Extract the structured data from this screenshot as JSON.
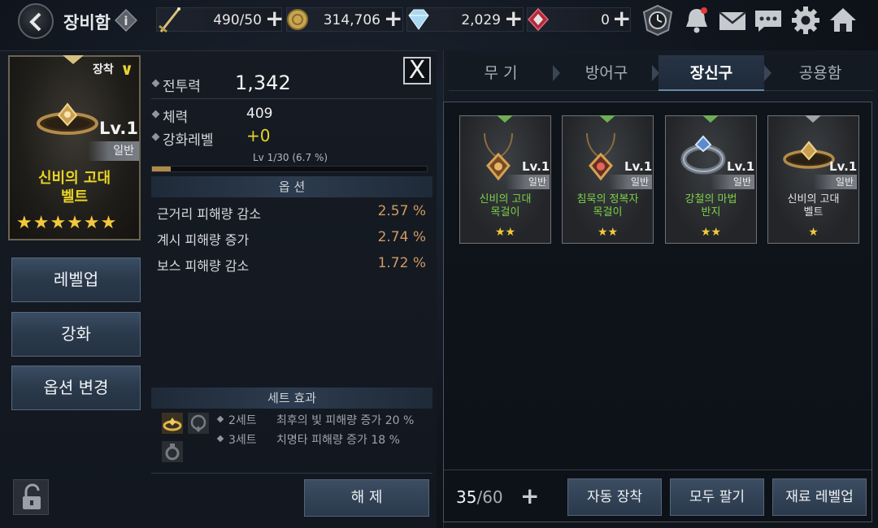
{
  "header": {
    "title": "장비함",
    "resources": [
      {
        "icon": "sword-icon",
        "value": "490/50"
      },
      {
        "icon": "gold-coin-icon",
        "value": "314,706"
      },
      {
        "icon": "diamond-gem-icon",
        "value": "2,029"
      },
      {
        "icon": "red-gem-icon",
        "value": "0"
      }
    ],
    "plus": "+"
  },
  "item": {
    "equip_label": "장착",
    "level": "Lv.1",
    "grade": "일반",
    "name_line1": "신비의 고대",
    "name_line2": "벨트",
    "stars": "★★★★★★",
    "star_count": 6
  },
  "left_buttons": {
    "levelup": "레벨업",
    "enhance": "강화",
    "option_change": "옵션 변경"
  },
  "stats": {
    "power_label": "전투력",
    "power_value": "1,342",
    "stamina_label": "체력",
    "stamina_value": "409",
    "enhance_label": "강화레벨",
    "enhance_value": "+0",
    "xp_text": "Lv 1/30  (6.7 %)",
    "xp_fraction": 0.067,
    "close": "X"
  },
  "options": {
    "header": "옵 션",
    "rows": [
      {
        "name": "근거리 피해량 감소",
        "value": "2.57 %"
      },
      {
        "name": "계시 피해량 증가",
        "value": "2.74 %"
      },
      {
        "name": "보스 피해량 감소",
        "value": "1.72 %"
      }
    ]
  },
  "set_effect": {
    "header": "세트 효과",
    "rows": [
      {
        "count": "2세트",
        "desc": "최후의 빛 피해량 증가 20 %"
      },
      {
        "count": "3세트",
        "desc": "치명타 피해량 증가 18 %"
      }
    ]
  },
  "release_button": "해 제",
  "tabs": [
    {
      "label": "무 기",
      "active": false
    },
    {
      "label": "방어구",
      "active": false
    },
    {
      "label": "장신구",
      "active": true
    },
    {
      "label": "공용함",
      "active": false
    }
  ],
  "inventory": {
    "slots": [
      {
        "name_line1": "신비의 고대",
        "name_line2": "목걸이",
        "level": "Lv.1",
        "grade": "일반",
        "stars": "★★",
        "name_color": "#7ed14a",
        "icon": "necklace-icon"
      },
      {
        "name_line1": "침묵의 정복자",
        "name_line2": "목걸이",
        "level": "Lv.1",
        "grade": "일반",
        "stars": "★★",
        "name_color": "#7ed14a",
        "icon": "necklace-icon"
      },
      {
        "name_line1": "강철의 마법",
        "name_line2": "반지",
        "level": "Lv.1",
        "grade": "일반",
        "stars": "★★",
        "name_color": "#7ed14a",
        "icon": "ring-icon"
      },
      {
        "name_line1": "신비의 고대",
        "name_line2": "벨트",
        "level": "Lv.1",
        "grade": "일반",
        "stars": "★",
        "name_color": "#e6e6e6",
        "icon": "belt-icon"
      }
    ],
    "count_current": "35",
    "count_sep": "/60",
    "add": "+"
  },
  "bottom_buttons": {
    "auto_equip": "자동 장착",
    "sell_all": "모두 팔기",
    "material_levelup": "재료 레벨업"
  },
  "colors": {
    "accent_gold": "#e9d426",
    "option_value": "#d09a62",
    "green_grade": "#7ed14a"
  }
}
